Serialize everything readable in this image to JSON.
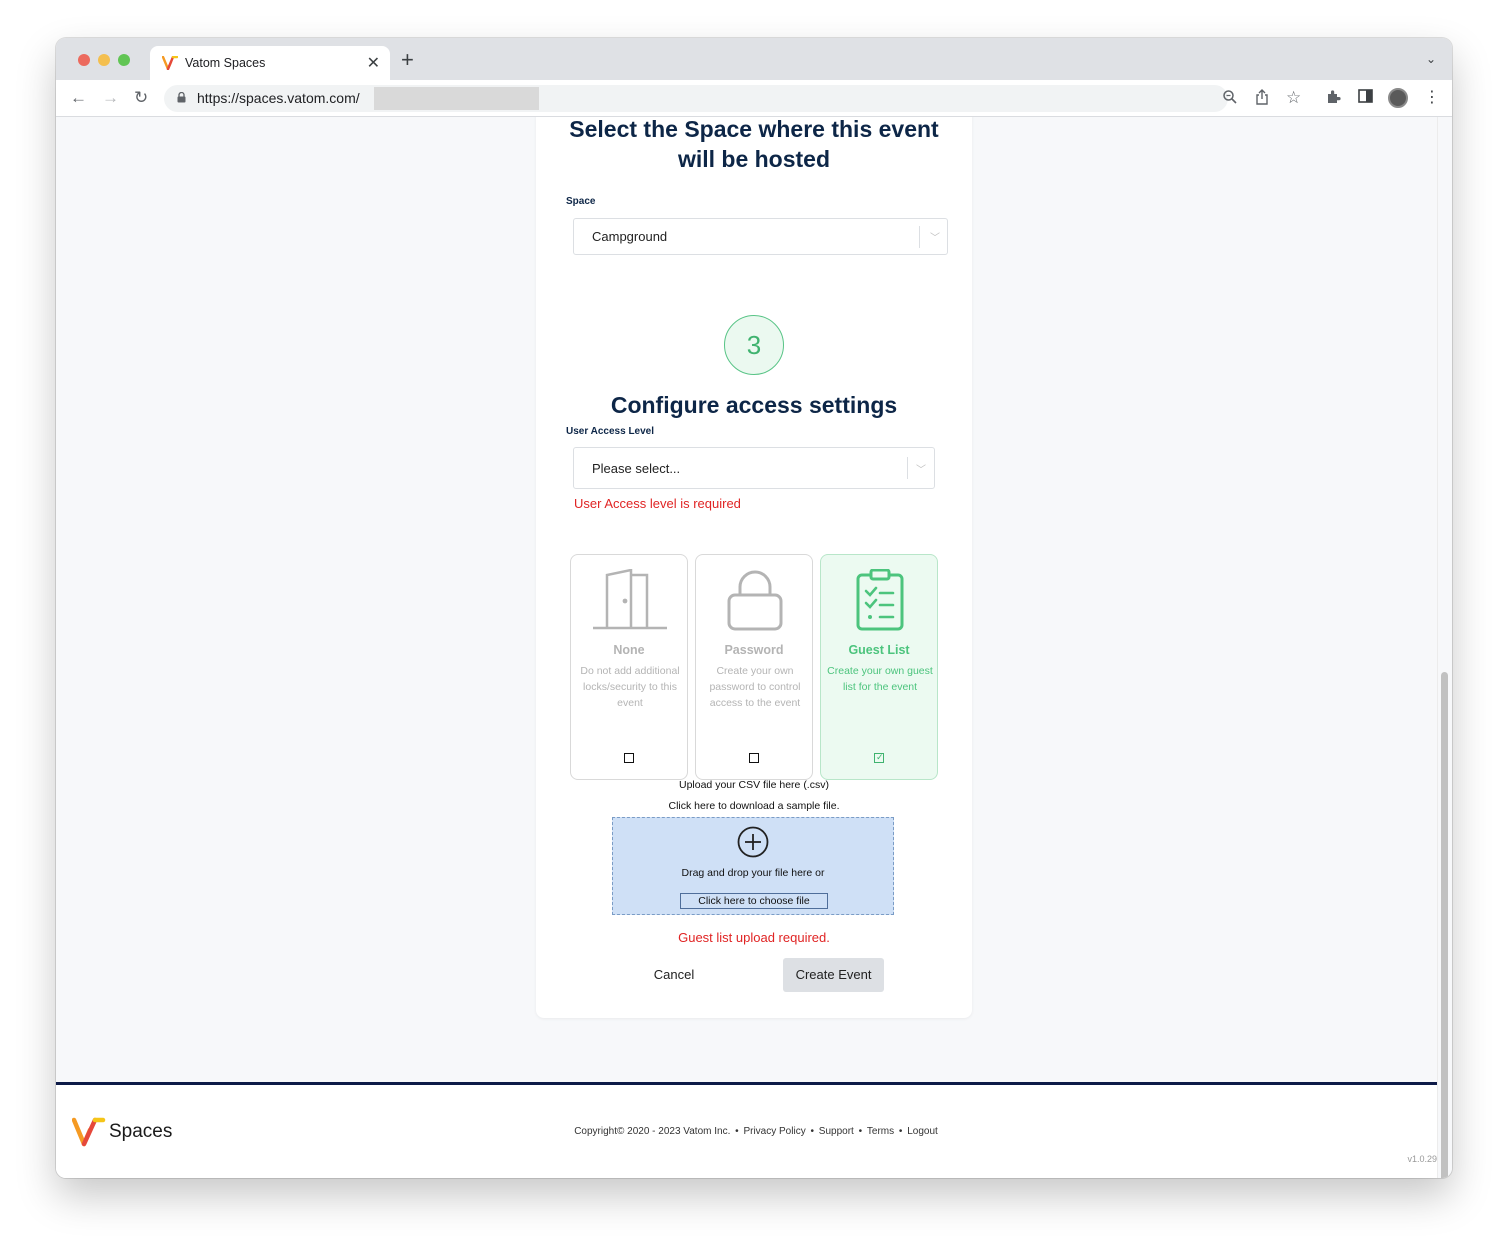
{
  "browser": {
    "tab_title": "Vatom Spaces",
    "tab_close": "✕",
    "new_tab": "+",
    "url": "https://spaces.vatom.com/"
  },
  "page": {
    "space_heading_line1": "Select the Space where this event",
    "space_heading_line2": "will be hosted",
    "space_label": "Space",
    "space_value": "Campground",
    "step_number": "3",
    "config_heading": "Configure access settings",
    "access_label": "User Access Level",
    "access_placeholder": "Please select...",
    "access_error": "User Access level is required",
    "options": [
      {
        "title": "None",
        "desc": "Do not add additional locks/security to this event",
        "checked": false,
        "icon": "door-icon"
      },
      {
        "title": "Password",
        "desc": "Create your own password to control access to the event",
        "checked": false,
        "icon": "lock-icon"
      },
      {
        "title": "Guest List",
        "desc": "Create your own guest list for the event",
        "checked": true,
        "icon": "clipboard-checklist-icon"
      }
    ],
    "upload_instructions": "Upload your CSV file here (.csv)",
    "sample_download": "Click here to download a sample file.",
    "drop_text": "Drag and drop your file here or",
    "choose_file": "Click here to choose file",
    "upload_error": "Guest list upload required.",
    "cancel_label": "Cancel",
    "create_label": "Create Event"
  },
  "footer": {
    "brand": "Spaces",
    "copyright": "Copyright© 2020 - 2023 Vatom Inc.",
    "links": [
      "Privacy Policy",
      "Support",
      "Terms",
      "Logout"
    ],
    "separator": "•",
    "version": "v1.0.29"
  },
  "colors": {
    "heading": "#0d2647",
    "accent_green": "#4cc47d",
    "error": "#e02424",
    "footer_rule": "#0d1a47"
  }
}
